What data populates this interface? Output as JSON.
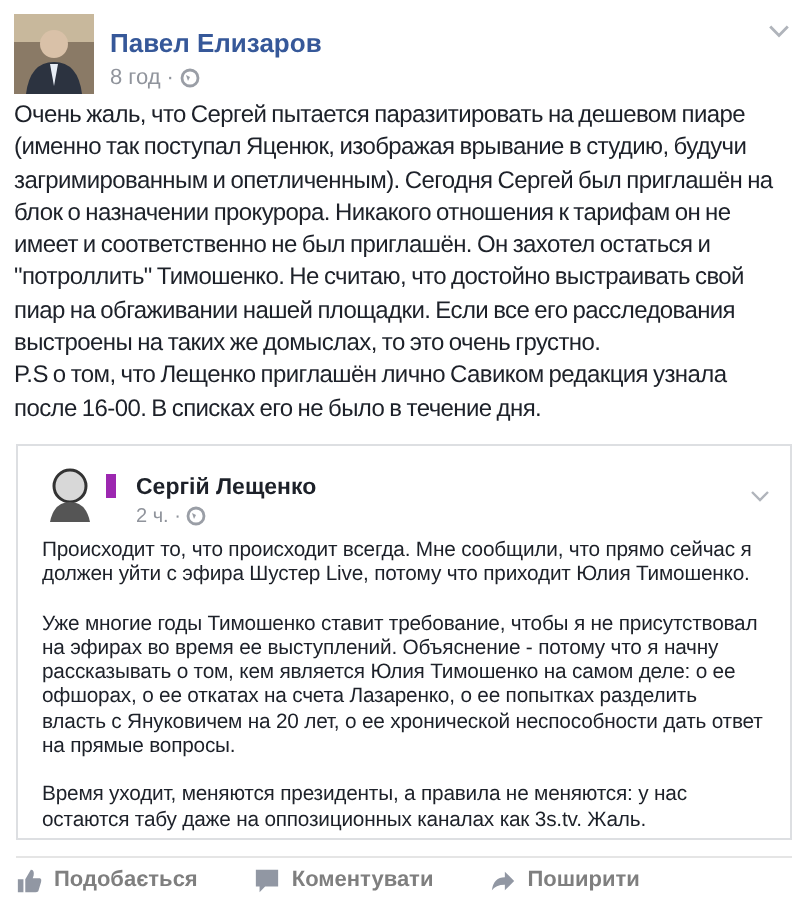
{
  "post": {
    "author": "Павел Елизаров",
    "time": "8 год ·",
    "paragraphs": [
      "Очень жаль, что Сергей пытается паразитировать на дешевом пиаре (именно так поступал Яценюк, изображая врывание в студию, будучи загримированным и опетличенным). Сегодня Сергей был приглашён на блок о назначении прокурора. Никакого отношения к тарифам он не имеет и соответственно не был приглашён. Он захотел остаться и \"потроллить\" Тимошенко. Не считаю, что достойно выстраивать свой пиар на обгаживании нашей площадки. Если все его расследования выстроены на таких же домыслах, то это очень грустно.",
      "P.S о том, что Лещенко приглашён лично Савиком редакция узнала после 16-00. В списках его не было в течение дня."
    ]
  },
  "shared_post": {
    "author": "Сергій Лещенко",
    "time": "2 ч. ·",
    "paragraphs": [
      "Происходит то, что происходит всегда. Мне сообщили, что прямо сейчас я должен уйти с эфира Шустер Live, потому что приходит Юлия Тимошенко.",
      "Уже многие годы Тимошенко ставит требование, чтобы я не присутствовал на эфирах во время ее выступлений. Объяснение - потому что я начну рассказывать о том, кем является Юлия Тимошенко на самом деле: о ее офшорах, о ее откатах на счета Лазаренко, о ее попытках разделить власть с Януковичем на 20 лет, о ее хронической неспособности дать ответ на прямые вопросы.",
      "Время уходит, меняются президенты, а правила не меняются: у нас остаются табу даже на оппозиционных каналах как 3s.tv. Жаль."
    ]
  },
  "actions": [
    {
      "kind": "like",
      "label": "Подобається"
    },
    {
      "kind": "comment",
      "label": "Коментувати"
    },
    {
      "kind": "share",
      "label": "Поширити"
    }
  ]
}
